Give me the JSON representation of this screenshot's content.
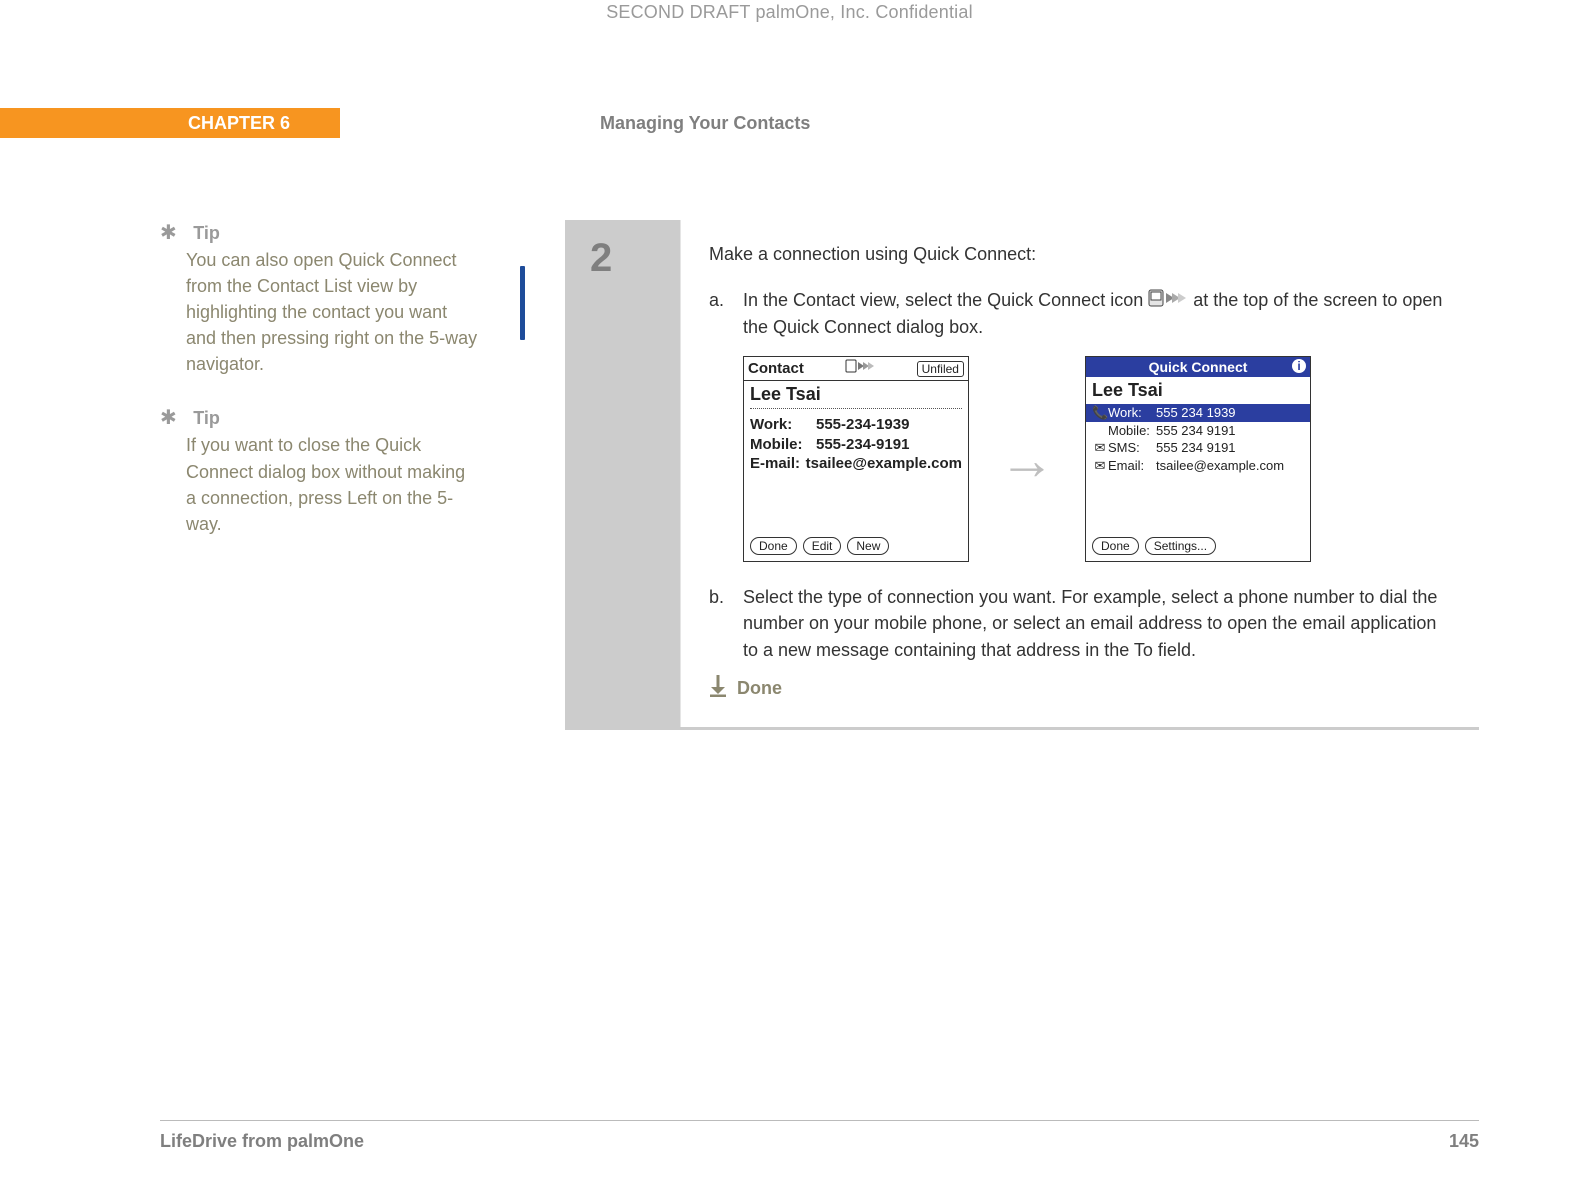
{
  "watermark": "SECOND DRAFT palmOne, Inc.  Confidential",
  "chapter_label": "CHAPTER 6",
  "section_title": "Managing Your Contacts",
  "tips": [
    {
      "heading": "Tip",
      "body": "You can also open Quick Connect from the Contact List view by highlighting the contact you want and then pressing right on the 5-way navigator."
    },
    {
      "heading": "Tip",
      "body": "If you want to close the Quick Connect dialog box without making a connection, press Left on the 5-way."
    }
  ],
  "step": {
    "number": "2",
    "intro": "Make a connection using Quick Connect:",
    "item_a_letter": "a.",
    "item_a_pre": "In the Contact view, select the Quick Connect icon ",
    "item_a_post": " at the top of the screen to open the Quick Connect dialog box.",
    "item_b_letter": "b.",
    "item_b_text": "Select the type of connection you want. For example, select a phone number to dial the number on your mobile phone, or select an email address to open the email application to a new message containing that address in the To field.",
    "done_label": "Done"
  },
  "screenA": {
    "title": "Contact",
    "category": "Unfiled",
    "name": "Lee Tsai",
    "rows": [
      {
        "label": "Work:",
        "value": "555-234-1939"
      },
      {
        "label": "Mobile:",
        "value": "555-234-9191"
      },
      {
        "label": "E-mail:",
        "value": "tsailee@example.com"
      }
    ],
    "buttons": {
      "done": "Done",
      "edit": "Edit",
      "new": "New"
    }
  },
  "screenB": {
    "title": "Quick Connect",
    "name": "Lee Tsai",
    "rows": [
      {
        "icon": "📞",
        "label": "Work:",
        "value": "555 234 1939",
        "selected": true
      },
      {
        "icon": "",
        "label": "Mobile:",
        "value": "555 234 9191",
        "selected": false
      },
      {
        "icon": "✉",
        "label": "SMS:",
        "value": "555 234 9191",
        "selected": false
      },
      {
        "icon": "✉",
        "label": "Email:",
        "value": "tsailee@example.com",
        "selected": false
      }
    ],
    "buttons": {
      "done": "Done",
      "settings": "Settings..."
    }
  },
  "footer": {
    "product": "LifeDrive from palmOne",
    "page": "145"
  }
}
